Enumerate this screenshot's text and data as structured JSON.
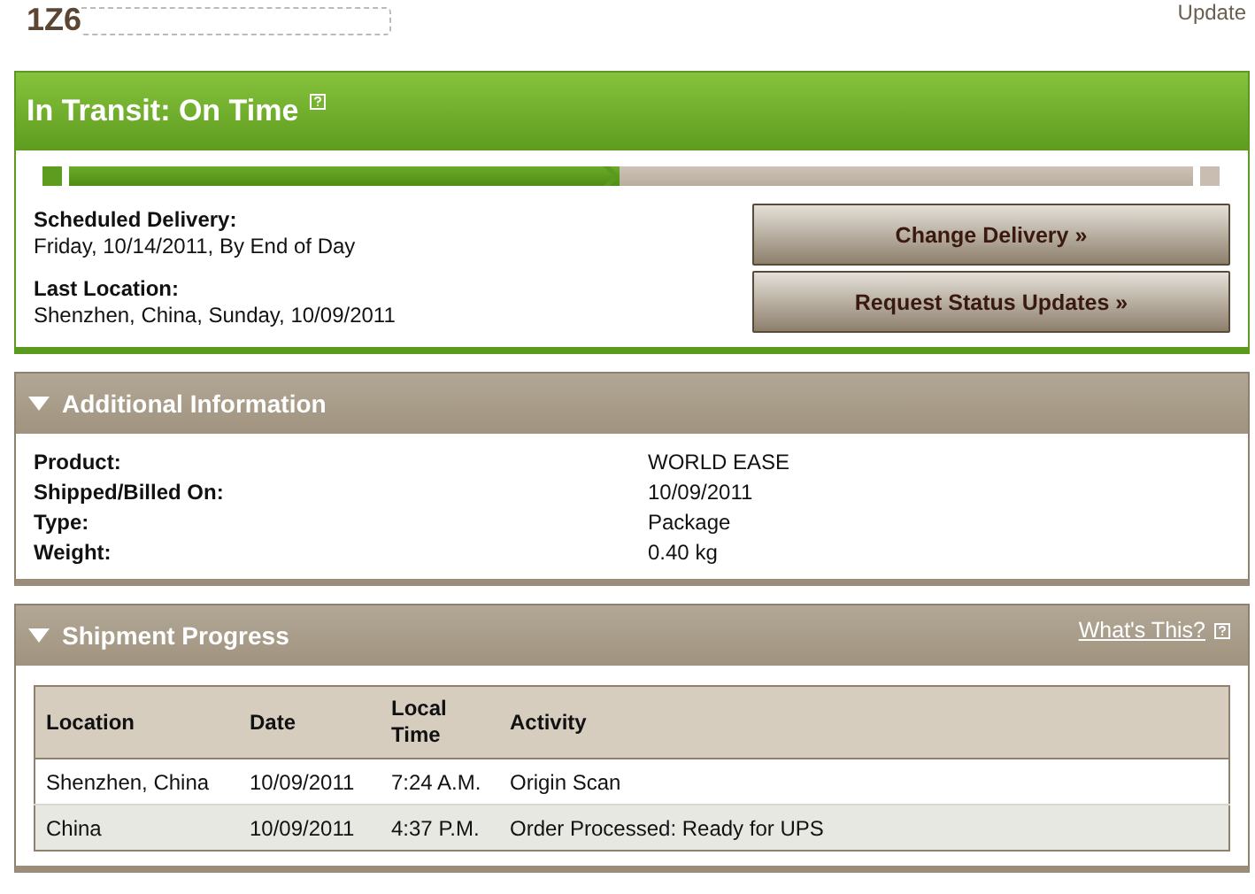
{
  "tracking": {
    "number": "1Z6",
    "updated": "Update"
  },
  "status": {
    "title": "In Transit: On Time",
    "level": 0.49,
    "details": [
      {
        "label": "Scheduled Delivery:",
        "value": "Friday, 10/14/2011, By End of Day"
      },
      {
        "label": "Last Location:",
        "value": "Shenzhen, China, Sunday, 10/09/2011"
      }
    ],
    "buttons": [
      "Change Delivery »",
      "Request Status Updates »"
    ]
  },
  "additional_information": {
    "title": "Additional Information",
    "expanded": true,
    "rows": [
      {
        "label": "Product:",
        "value": "WORLD EASE"
      },
      {
        "label": "Shipped/Billed On:",
        "value": "10/09/2011"
      },
      {
        "label": "Type:",
        "value": "Package"
      },
      {
        "label": "Weight:",
        "value": "0.40 kg"
      }
    ]
  },
  "shipment_progress": {
    "title": "Shipment Progress",
    "expanded": true,
    "help_link": "What's This?",
    "table": {
      "columns": [
        "Location",
        "Date",
        "Local Time",
        "Activity"
      ],
      "rows": [
        [
          "Shenzhen, China",
          "10/09/2011",
          "7:24 A.M.",
          "Origin Scan"
        ],
        [
          "China",
          "10/09/2011",
          "4:37 P.M.",
          "Order Processed: Ready for UPS"
        ]
      ]
    }
  }
}
